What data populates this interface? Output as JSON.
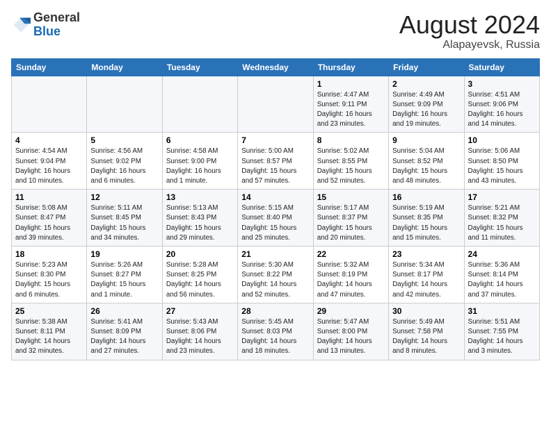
{
  "header": {
    "logo_line1": "General",
    "logo_line2": "Blue",
    "month_year": "August 2024",
    "location": "Alapayevsk, Russia"
  },
  "days_of_week": [
    "Sunday",
    "Monday",
    "Tuesday",
    "Wednesday",
    "Thursday",
    "Friday",
    "Saturday"
  ],
  "weeks": [
    [
      {
        "num": "",
        "sunrise": "",
        "sunset": "",
        "daylight": ""
      },
      {
        "num": "",
        "sunrise": "",
        "sunset": "",
        "daylight": ""
      },
      {
        "num": "",
        "sunrise": "",
        "sunset": "",
        "daylight": ""
      },
      {
        "num": "",
        "sunrise": "",
        "sunset": "",
        "daylight": ""
      },
      {
        "num": "1",
        "sunrise": "Sunrise: 4:47 AM",
        "sunset": "Sunset: 9:11 PM",
        "daylight": "Daylight: 16 hours and 23 minutes."
      },
      {
        "num": "2",
        "sunrise": "Sunrise: 4:49 AM",
        "sunset": "Sunset: 9:09 PM",
        "daylight": "Daylight: 16 hours and 19 minutes."
      },
      {
        "num": "3",
        "sunrise": "Sunrise: 4:51 AM",
        "sunset": "Sunset: 9:06 PM",
        "daylight": "Daylight: 16 hours and 14 minutes."
      }
    ],
    [
      {
        "num": "4",
        "sunrise": "Sunrise: 4:54 AM",
        "sunset": "Sunset: 9:04 PM",
        "daylight": "Daylight: 16 hours and 10 minutes."
      },
      {
        "num": "5",
        "sunrise": "Sunrise: 4:56 AM",
        "sunset": "Sunset: 9:02 PM",
        "daylight": "Daylight: 16 hours and 6 minutes."
      },
      {
        "num": "6",
        "sunrise": "Sunrise: 4:58 AM",
        "sunset": "Sunset: 9:00 PM",
        "daylight": "Daylight: 16 hours and 1 minute."
      },
      {
        "num": "7",
        "sunrise": "Sunrise: 5:00 AM",
        "sunset": "Sunset: 8:57 PM",
        "daylight": "Daylight: 15 hours and 57 minutes."
      },
      {
        "num": "8",
        "sunrise": "Sunrise: 5:02 AM",
        "sunset": "Sunset: 8:55 PM",
        "daylight": "Daylight: 15 hours and 52 minutes."
      },
      {
        "num": "9",
        "sunrise": "Sunrise: 5:04 AM",
        "sunset": "Sunset: 8:52 PM",
        "daylight": "Daylight: 15 hours and 48 minutes."
      },
      {
        "num": "10",
        "sunrise": "Sunrise: 5:06 AM",
        "sunset": "Sunset: 8:50 PM",
        "daylight": "Daylight: 15 hours and 43 minutes."
      }
    ],
    [
      {
        "num": "11",
        "sunrise": "Sunrise: 5:08 AM",
        "sunset": "Sunset: 8:47 PM",
        "daylight": "Daylight: 15 hours and 39 minutes."
      },
      {
        "num": "12",
        "sunrise": "Sunrise: 5:11 AM",
        "sunset": "Sunset: 8:45 PM",
        "daylight": "Daylight: 15 hours and 34 minutes."
      },
      {
        "num": "13",
        "sunrise": "Sunrise: 5:13 AM",
        "sunset": "Sunset: 8:43 PM",
        "daylight": "Daylight: 15 hours and 29 minutes."
      },
      {
        "num": "14",
        "sunrise": "Sunrise: 5:15 AM",
        "sunset": "Sunset: 8:40 PM",
        "daylight": "Daylight: 15 hours and 25 minutes."
      },
      {
        "num": "15",
        "sunrise": "Sunrise: 5:17 AM",
        "sunset": "Sunset: 8:37 PM",
        "daylight": "Daylight: 15 hours and 20 minutes."
      },
      {
        "num": "16",
        "sunrise": "Sunrise: 5:19 AM",
        "sunset": "Sunset: 8:35 PM",
        "daylight": "Daylight: 15 hours and 15 minutes."
      },
      {
        "num": "17",
        "sunrise": "Sunrise: 5:21 AM",
        "sunset": "Sunset: 8:32 PM",
        "daylight": "Daylight: 15 hours and 11 minutes."
      }
    ],
    [
      {
        "num": "18",
        "sunrise": "Sunrise: 5:23 AM",
        "sunset": "Sunset: 8:30 PM",
        "daylight": "Daylight: 15 hours and 6 minutes."
      },
      {
        "num": "19",
        "sunrise": "Sunrise: 5:26 AM",
        "sunset": "Sunset: 8:27 PM",
        "daylight": "Daylight: 15 hours and 1 minute."
      },
      {
        "num": "20",
        "sunrise": "Sunrise: 5:28 AM",
        "sunset": "Sunset: 8:25 PM",
        "daylight": "Daylight: 14 hours and 56 minutes."
      },
      {
        "num": "21",
        "sunrise": "Sunrise: 5:30 AM",
        "sunset": "Sunset: 8:22 PM",
        "daylight": "Daylight: 14 hours and 52 minutes."
      },
      {
        "num": "22",
        "sunrise": "Sunrise: 5:32 AM",
        "sunset": "Sunset: 8:19 PM",
        "daylight": "Daylight: 14 hours and 47 minutes."
      },
      {
        "num": "23",
        "sunrise": "Sunrise: 5:34 AM",
        "sunset": "Sunset: 8:17 PM",
        "daylight": "Daylight: 14 hours and 42 minutes."
      },
      {
        "num": "24",
        "sunrise": "Sunrise: 5:36 AM",
        "sunset": "Sunset: 8:14 PM",
        "daylight": "Daylight: 14 hours and 37 minutes."
      }
    ],
    [
      {
        "num": "25",
        "sunrise": "Sunrise: 5:38 AM",
        "sunset": "Sunset: 8:11 PM",
        "daylight": "Daylight: 14 hours and 32 minutes."
      },
      {
        "num": "26",
        "sunrise": "Sunrise: 5:41 AM",
        "sunset": "Sunset: 8:09 PM",
        "daylight": "Daylight: 14 hours and 27 minutes."
      },
      {
        "num": "27",
        "sunrise": "Sunrise: 5:43 AM",
        "sunset": "Sunset: 8:06 PM",
        "daylight": "Daylight: 14 hours and 23 minutes."
      },
      {
        "num": "28",
        "sunrise": "Sunrise: 5:45 AM",
        "sunset": "Sunset: 8:03 PM",
        "daylight": "Daylight: 14 hours and 18 minutes."
      },
      {
        "num": "29",
        "sunrise": "Sunrise: 5:47 AM",
        "sunset": "Sunset: 8:00 PM",
        "daylight": "Daylight: 14 hours and 13 minutes."
      },
      {
        "num": "30",
        "sunrise": "Sunrise: 5:49 AM",
        "sunset": "Sunset: 7:58 PM",
        "daylight": "Daylight: 14 hours and 8 minutes."
      },
      {
        "num": "31",
        "sunrise": "Sunrise: 5:51 AM",
        "sunset": "Sunset: 7:55 PM",
        "daylight": "Daylight: 14 hours and 3 minutes."
      }
    ]
  ]
}
